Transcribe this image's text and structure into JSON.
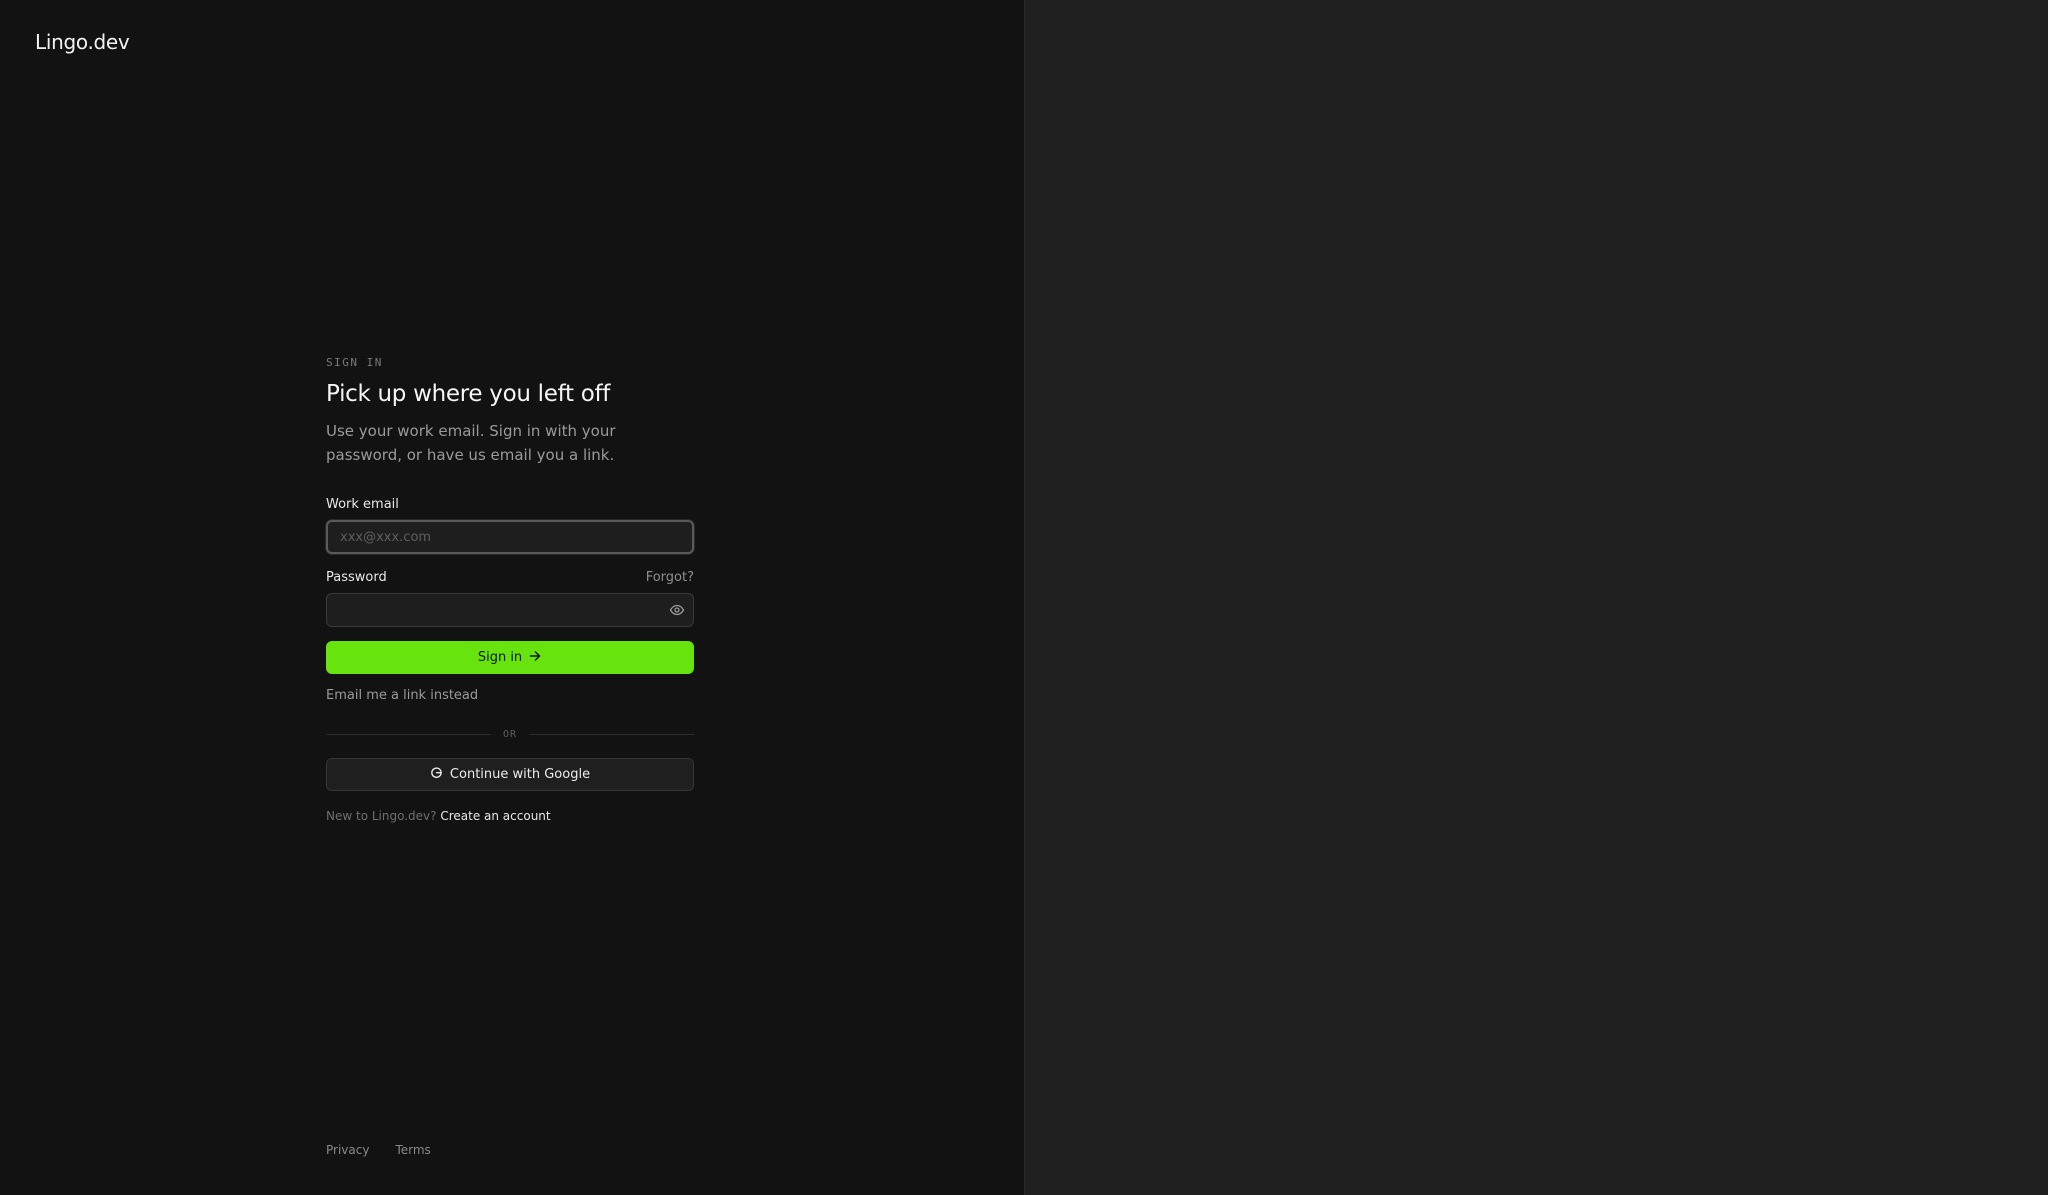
{
  "brand": {
    "logo_text": "Lingo.dev"
  },
  "form": {
    "eyebrow": "SIGN IN",
    "title": "Pick up where you left off",
    "subtitle": "Use your work email. Sign in with your password, or have us email you a link.",
    "email": {
      "label": "Work email",
      "placeholder": "xxx@xxx.com",
      "value": ""
    },
    "password": {
      "label": "Password",
      "forgot_label": "Forgot?",
      "value": ""
    },
    "submit_label": "Sign in",
    "magic_link_label": "Email me a link instead",
    "divider_label": "OR",
    "google_label": "Continue with Google",
    "signup_prompt": "New to Lingo.dev?",
    "signup_link": "Create an account"
  },
  "footer": {
    "privacy": "Privacy",
    "terms": "Terms"
  },
  "colors": {
    "accent": "#67e30d",
    "left_bg": "#121212",
    "right_bg": "#202020"
  },
  "icons": {
    "password_toggle": "eye-icon",
    "submit": "arrow-right-icon",
    "google": "google-icon"
  }
}
